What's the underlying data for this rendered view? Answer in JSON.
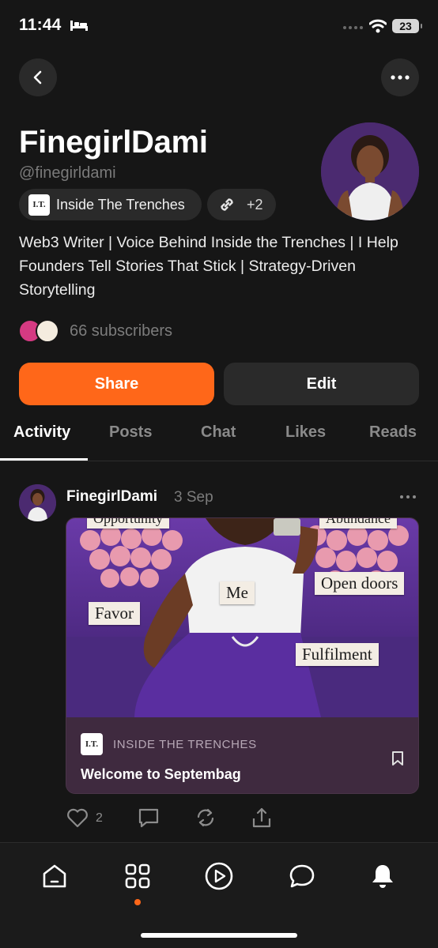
{
  "status_bar": {
    "time": "11:44",
    "battery": "23"
  },
  "profile": {
    "name": "FinegirlDami",
    "handle": "@finegirldami",
    "publication_chip": {
      "logo_text": "I.T.",
      "label": "Inside The Trenches"
    },
    "links_chip": {
      "count": "+2"
    },
    "bio": "Web3 Writer | Voice Behind Inside the Trenches | I Help Founders Tell Stories That Stick | Strategy-Driven Storytelling",
    "subscribers": "66 subscribers"
  },
  "buttons": {
    "share": "Share",
    "edit": "Edit"
  },
  "tabs": [
    "Activity",
    "Posts",
    "Chat",
    "Likes",
    "Reads"
  ],
  "active_tab": "Activity",
  "post": {
    "author": "FinegirlDami",
    "date": "3 Sep",
    "image_labels": [
      "Opportunity",
      "Abundance",
      "Me",
      "Open doors",
      "Favor",
      "Fulfilment"
    ],
    "card": {
      "publication_logo": "I.T.",
      "publication": "INSIDE THE TRENCHES",
      "title": "Welcome to Septembag"
    },
    "likes": "2"
  },
  "icons": {
    "status": [
      "bed-icon",
      "signal-icon",
      "wifi-icon",
      "battery-icon"
    ],
    "header": [
      "back-icon",
      "more-icon"
    ],
    "actions": [
      "heart-icon",
      "comment-icon",
      "restack-icon",
      "share-icon"
    ],
    "nav": [
      "home-icon",
      "grid-icon",
      "play-icon",
      "chat-icon",
      "bell-icon"
    ]
  },
  "colors": {
    "accent": "#ff6719",
    "background": "#161616",
    "surface": "#2a2a2a",
    "card": "#3f2a3f",
    "muted": "#7c7c7c"
  }
}
